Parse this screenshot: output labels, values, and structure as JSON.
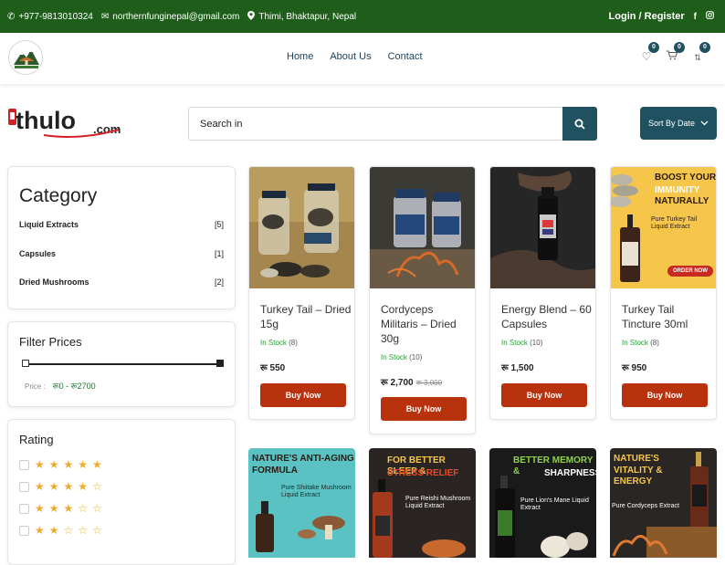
{
  "topbar": {
    "phone": "+977-9813010324",
    "email": "northernfunginepal@gmail.com",
    "location": "Thimi, Bhaktapur, Nepal",
    "login": "Login / Register"
  },
  "nav": {
    "links": [
      "Home",
      "About Us",
      "Contact"
    ],
    "wishlist_count": "0",
    "cart_count": "0",
    "compare_count": "0"
  },
  "brand": {
    "logo_main": "thulo",
    "logo_suffix": ".com"
  },
  "search": {
    "placeholder": "Search in"
  },
  "sort": {
    "label": "Sort By Date"
  },
  "category": {
    "title": "Category",
    "items": [
      {
        "label": "Liquid Extracts",
        "count": "[5]"
      },
      {
        "label": "Capsules",
        "count": "[1]"
      },
      {
        "label": "Dried Mushrooms",
        "count": "[2]"
      }
    ]
  },
  "filter": {
    "title": "Filter Prices",
    "price_label": "Price :",
    "price_range": "रू0 - रू2700"
  },
  "rating": {
    "title": "Rating",
    "levels": [
      5,
      4,
      3,
      2
    ]
  },
  "products": [
    {
      "name": "Turkey Tail – Dried 15g",
      "stock": "In Stock",
      "qty": "(8)",
      "price": "रू 550",
      "old_price": "",
      "button": "Buy Now"
    },
    {
      "name": "Cordyceps Militaris – Dried 30g",
      "stock": "In Stock",
      "qty": "(10)",
      "price": "रू 2,700",
      "old_price": "रू 3,000",
      "button": "Buy Now"
    },
    {
      "name": "Energy Blend – 60 Capsules",
      "stock": "In Stock",
      "qty": "(10)",
      "price": "रू 1,500",
      "old_price": "",
      "button": "Buy Now"
    },
    {
      "name": "Turkey Tail Tincture 30ml",
      "stock": "In Stock",
      "qty": "(8)",
      "price": "रू 950",
      "old_price": "",
      "button": "Buy Now"
    }
  ],
  "promo4": {
    "line1": "BOOST YOUR",
    "line2": "IMMUNITY",
    "line3": "NATURALLY",
    "product": "Pure Turkey Tail Liquid Extract",
    "cta": "ORDER NOW"
  },
  "row2": [
    {
      "t1": "NATURE'S ANTI-AGING",
      "t2": "FORMULA",
      "sub": "Pure Shiitake Mushroom Liquid Extract"
    },
    {
      "t1": "FOR BETTER SLEEP &",
      "t2": "STRESS RELIEF",
      "sub": "Pure Reishi Mushroom Liquid Extract"
    },
    {
      "t1": "BETTER MEMORY &",
      "t2": "SHARPNESS",
      "sub": "Pure Lion's Mane Liquid Extract"
    },
    {
      "t1": "NATURE'S",
      "t2": "VITALITY & ENERGY",
      "sub": "Pure Cordyceps Extract"
    }
  ]
}
